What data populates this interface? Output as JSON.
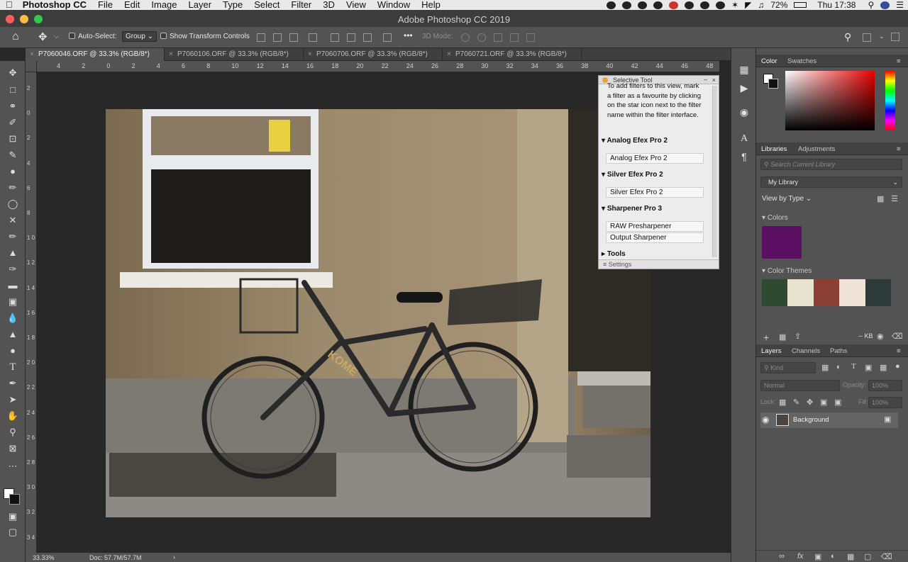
{
  "menubar": {
    "app_name": "Photoshop CC",
    "items": [
      "File",
      "Edit",
      "Image",
      "Layer",
      "Type",
      "Select",
      "Filter",
      "3D",
      "View",
      "Window",
      "Help"
    ],
    "battery": "72%",
    "clock": "Thu 17:38"
  },
  "window": {
    "title": "Adobe Photoshop CC 2019"
  },
  "options_bar": {
    "auto_select_label": "Auto-Select:",
    "auto_select_value": "Group",
    "show_transform_label": "Show Transform Controls",
    "mode_3d_label": "3D Mode:",
    "more_label": "•••"
  },
  "tabs": [
    {
      "label": "P7060046.ORF @ 33.3% (RGB/8*)",
      "active": true
    },
    {
      "label": "P7060106.ORF @ 33.3% (RGB/8*)",
      "active": false
    },
    {
      "label": "P7060706.ORF @ 33.3% (RGB/8*)",
      "active": false
    },
    {
      "label": "P7060721.ORF @ 33.3% (RGB/8*)",
      "active": false
    }
  ],
  "ruler_h": [
    "4",
    "2",
    "0",
    "2",
    "4",
    "6",
    "8",
    "10",
    "12",
    "14",
    "16",
    "18",
    "20",
    "22",
    "24",
    "26",
    "28",
    "30",
    "32",
    "34",
    "36",
    "38",
    "40",
    "42",
    "44",
    "46",
    "48"
  ],
  "ruler_v": [
    "2",
    "0",
    "2",
    "4",
    "6",
    "8",
    "1 0",
    "1 2",
    "1 4",
    "1 6",
    "1 8",
    "2 0",
    "2 2",
    "2 4",
    "2 6",
    "2 8",
    "3 0",
    "3 2",
    "3 4"
  ],
  "status": {
    "zoom": "33.33%",
    "doc": "Doc: 57.7M/57.7M",
    "arrow": "›"
  },
  "selective_tool": {
    "title": "Selective Tool",
    "intro": "To add filters to this view, mark a filter as a favourite by clicking on the star icon next to the filter name within the filter interface.",
    "sections": [
      {
        "name": "Analog Efex Pro 2",
        "buttons": [
          "Analog Efex Pro 2"
        ]
      },
      {
        "name": "Silver Efex Pro 2",
        "buttons": [
          "Silver Efex Pro 2"
        ]
      },
      {
        "name": "Sharpener Pro 3",
        "buttons": [
          "RAW Presharpener",
          "Output Sharpener"
        ]
      },
      {
        "name": "Tools",
        "buttons": []
      }
    ],
    "settings_label": "Settings"
  },
  "color_panel": {
    "tabs": [
      "Color",
      "Swatches"
    ]
  },
  "libraries_panel": {
    "tabs": [
      "Libraries",
      "Adjustments"
    ],
    "search_placeholder": "Search Current Library",
    "library_name": "My Library",
    "view_by": "View by Type",
    "colors_header": "Colors",
    "color_swatch": "#5a0f63",
    "themes_header": "Color Themes",
    "theme_colors": [
      "#2e4a30",
      "#e8e2d0",
      "#8c4035",
      "#f0e2d6",
      "#2c3a38"
    ],
    "footer_size": "-- KB"
  },
  "layers_panel": {
    "tabs": [
      "Layers",
      "Channels",
      "Paths"
    ],
    "kind_label": "Kind",
    "blend_mode": "Normal",
    "opacity_label": "Opacity:",
    "opacity_value": "100%",
    "lock_label": "Lock:",
    "fill_label": "Fill:",
    "fill_value": "100%",
    "layers": [
      {
        "name": "Background",
        "visible": true,
        "locked": true
      }
    ]
  }
}
